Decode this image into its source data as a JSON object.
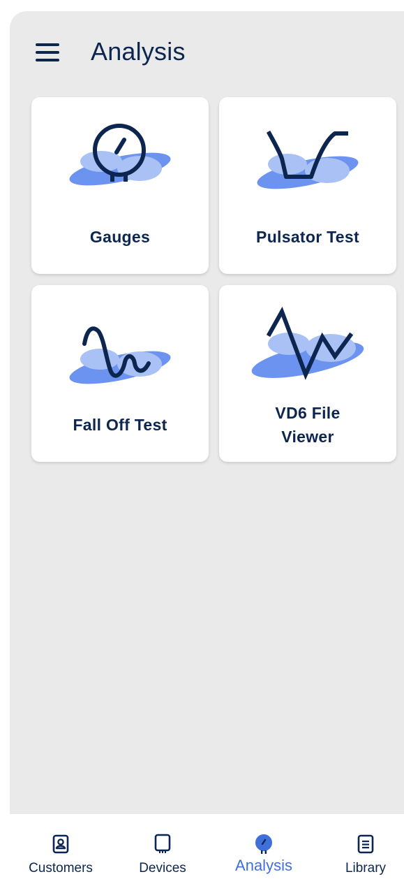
{
  "header": {
    "title": "Analysis",
    "menu_icon": "hamburger-menu-icon"
  },
  "cards": [
    {
      "label": "Gauges",
      "icon": "gauge-icon"
    },
    {
      "label": "Pulsator Test",
      "icon": "pulsator-curve-icon"
    },
    {
      "label": "Fall Off Test",
      "icon": "fall-off-wave-icon"
    },
    {
      "label": "VD6 File\nViewer",
      "icon": "zigzag-graph-icon"
    }
  ],
  "bottom_nav": {
    "items": [
      {
        "label": "Customers",
        "icon": "contact-card-icon",
        "active": false
      },
      {
        "label": "Devices",
        "icon": "device-icon",
        "active": false
      },
      {
        "label": "Analysis",
        "icon": "gauge-icon",
        "active": true
      },
      {
        "label": "Library",
        "icon": "document-icon",
        "active": false
      }
    ]
  },
  "colors": {
    "primary_text": "#0c2650",
    "accent": "#3f6fd8",
    "blob_main": "#6b93ef",
    "blob_light": "#a9c1f5",
    "background": "#eaeaea",
    "card": "#ffffff"
  }
}
